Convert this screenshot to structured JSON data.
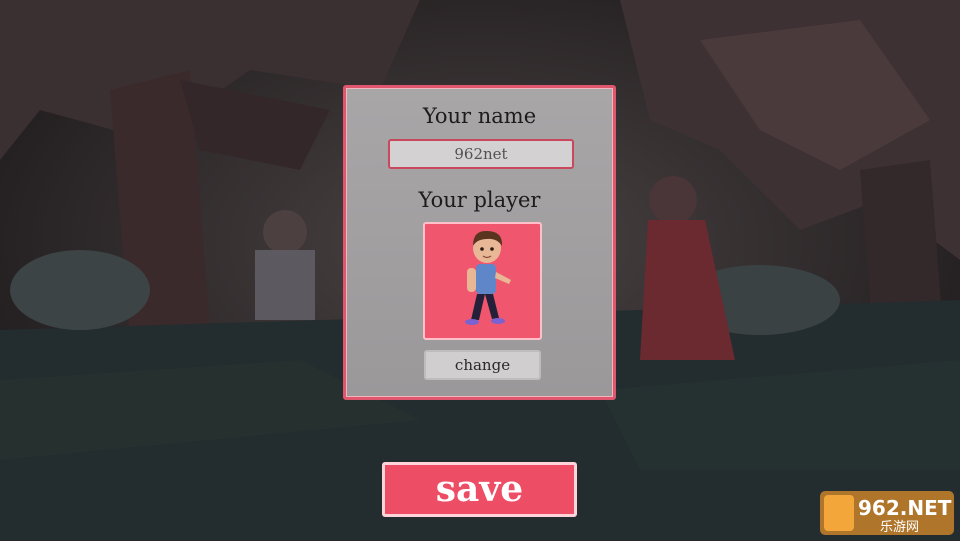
{
  "profile": {
    "name_label": "Your name",
    "name_value": "962net",
    "player_label": "Your player",
    "change_label": "change",
    "save_label": "save"
  },
  "watermark": {
    "brand": "962.NET",
    "subtitle": "乐游网"
  },
  "colors": {
    "accent": "#ee4d66",
    "panel": "#a8a6a7",
    "background": "#2a2526"
  }
}
